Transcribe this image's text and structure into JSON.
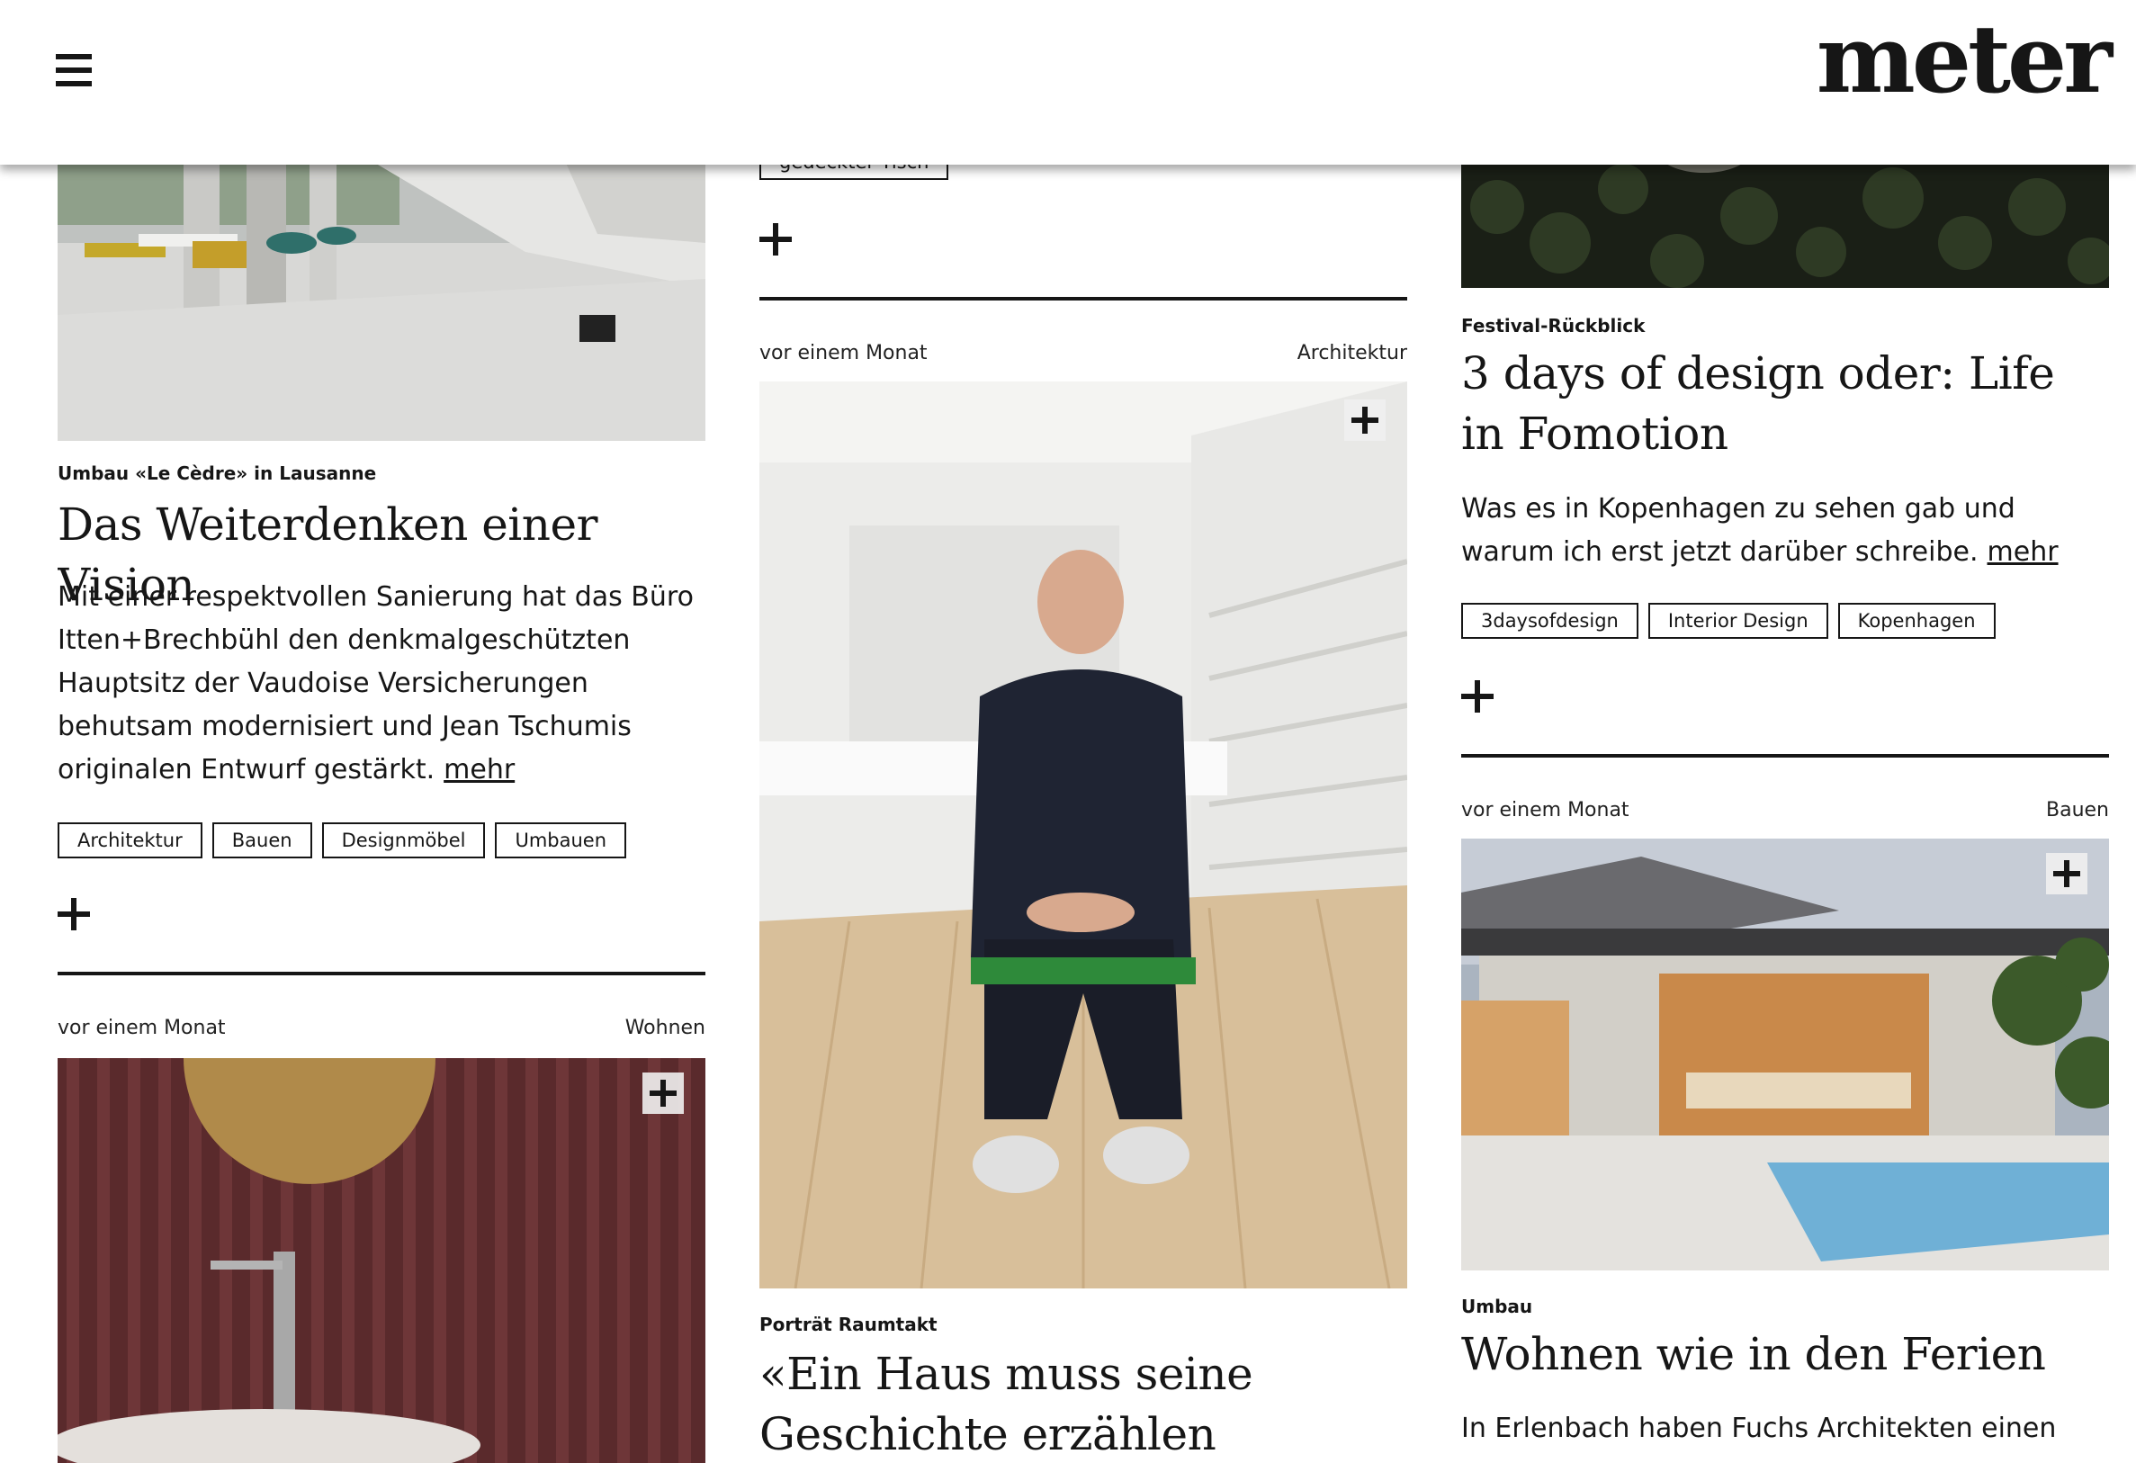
{
  "header": {
    "logo": "meter",
    "menu_icon": "hamburger-menu-icon"
  },
  "col1": {
    "article1": {
      "kicker": "Umbau «Le Cèdre» in Lausanne",
      "title": "Das Weiterdenken einer Vision",
      "teaser": "Mit einer respektvollen Sanierung hat das Büro Itten+Brechbühl den denkmalgeschützten Hauptsitz der Vaudoise Versicherungen behutsam modernisiert und Jean Tschumis originalen Entwurf gestärkt.",
      "more": "mehr",
      "tags": [
        "Architektur",
        "Bauen",
        "Designmöbel",
        "Umbauen"
      ]
    },
    "article2": {
      "date": "vor einem Monat",
      "category": "Wohnen"
    }
  },
  "col2": {
    "partial_tag": "gedeckter Tisch",
    "article": {
      "date": "vor einem Monat",
      "category": "Architektur",
      "kicker": "Porträt Raumtakt",
      "title": "«Ein Haus muss seine Geschichte erzählen können»"
    }
  },
  "col3": {
    "article1": {
      "kicker": "Festival-Rückblick",
      "title": "3 days of design oder: Life in Fomotion",
      "teaser": "Was es in Kopenhagen zu sehen gab und warum ich erst jetzt darüber schreibe.",
      "more": "mehr",
      "tags": [
        "3daysofdesign",
        "Interior Design",
        "Kopenhagen"
      ]
    },
    "article2": {
      "date": "vor einem Monat",
      "category": "Bauen",
      "kicker": "Umbau",
      "title": "Wohnen wie in den Ferien",
      "teaser": "In Erlenbach haben Fuchs Architekten einen"
    }
  }
}
